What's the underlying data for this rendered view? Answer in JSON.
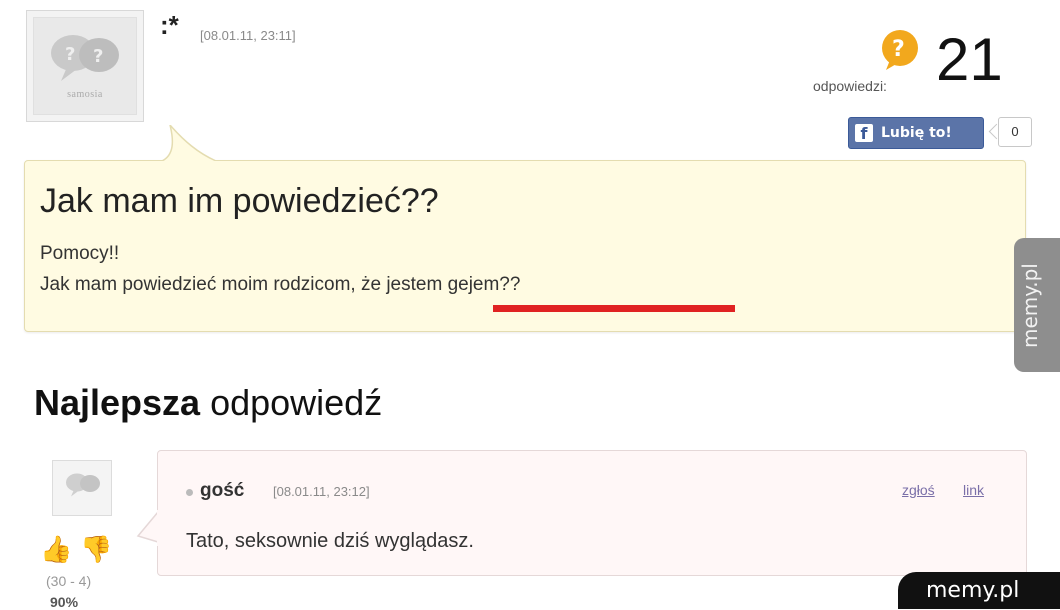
{
  "question": {
    "author": ":*",
    "date": "[08.01.11, 23:11]",
    "title": "Jak mam im powiedzieć??",
    "line1": "Pomocy!!",
    "line2": "Jak mam powiedzieć moim rodzicom, że jestem gejem??"
  },
  "answers": {
    "label": "odpowiedzi:",
    "count": "21"
  },
  "like": {
    "button_label": "Lubię to!",
    "count": "0"
  },
  "avatar": {
    "logo_text": "samosia"
  },
  "best_answer": {
    "heading_bold": "Najlepsza",
    "heading_rest": " odpowiedź",
    "author": "gość",
    "date": "[08.01.11, 23:12]",
    "report_label": "zgłoś",
    "link_label": "link",
    "text": "Tato, seksownie dziś wyglądasz.",
    "votes": "(30 - 4)",
    "percent": "90%"
  },
  "watermark": {
    "side": "memy.pl",
    "bottom": "memy.pl"
  },
  "colors": {
    "question_bg": "#fffbe2",
    "underline": "#e02222",
    "facebook": "#5b74a8",
    "answer_bg": "#fff7f7"
  }
}
